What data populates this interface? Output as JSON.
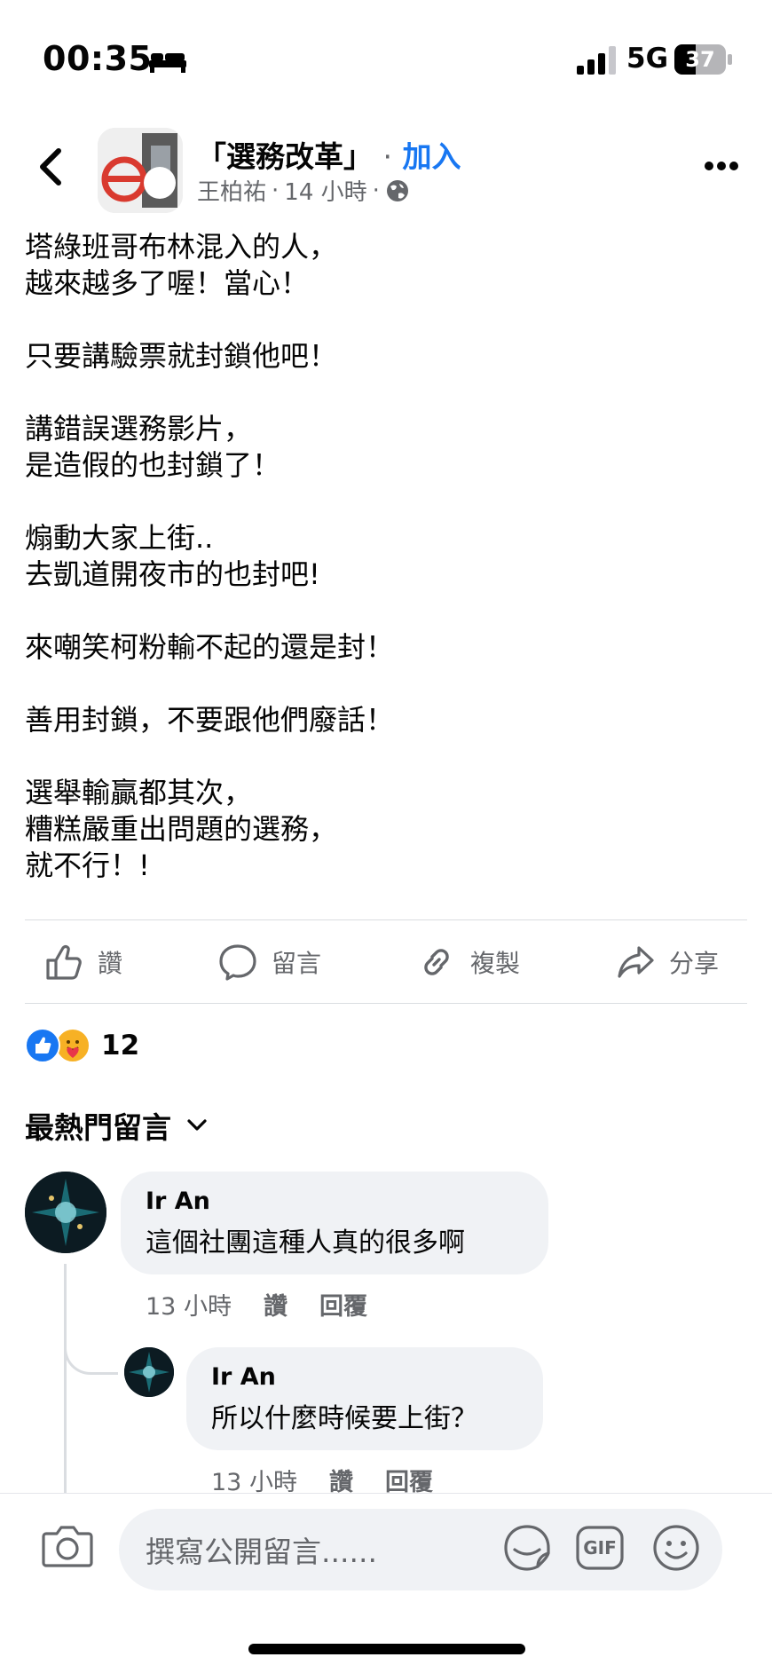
{
  "status_bar": {
    "time": "00:35",
    "network": "5G",
    "battery": "37"
  },
  "header": {
    "group_name": "「選務改革」",
    "separator": "·",
    "join_label": "加入",
    "author": "王柏祐",
    "time": "14 小時",
    "dot": "·",
    "audience_icon": "globe-icon"
  },
  "post": {
    "lines": [
      "塔綠班哥布林混入的人，",
      "越來越多了喔！當心！",
      "",
      "只要講驗票就封鎖他吧！",
      "",
      "講錯誤選務影片，",
      "是造假的也封鎖了！",
      "",
      "煽動大家上街..",
      "去凱道開夜市的也封吧!",
      "",
      "來嘲笑柯粉輸不起的還是封！",
      "",
      "善用封鎖，不要跟他們廢話！",
      "",
      "選舉輸贏都其次，",
      "糟糕嚴重出問題的選務，",
      "就不行！!"
    ]
  },
  "actions": {
    "like": "讚",
    "comment": "留言",
    "copy": "複製",
    "share": "分享"
  },
  "reactions": {
    "count": "12",
    "types": [
      "like",
      "care"
    ]
  },
  "comments_sort": "最熱門留言",
  "comments": [
    {
      "name": "Ir An",
      "text": "這個社團這種人真的很多啊",
      "time": "13 小時",
      "like": "讚",
      "reply": "回覆"
    },
    {
      "name": "Ir An",
      "text": "所以什麼時候要上街？",
      "time": "13 小時",
      "like": "讚",
      "reply": "回覆"
    }
  ],
  "composer": {
    "placeholder": "撰寫公開留言......",
    "gif_label": "GIF"
  },
  "colors": {
    "accent": "#1877f2",
    "secondary_text": "#65676b",
    "bubble": "#f0f2f5"
  }
}
